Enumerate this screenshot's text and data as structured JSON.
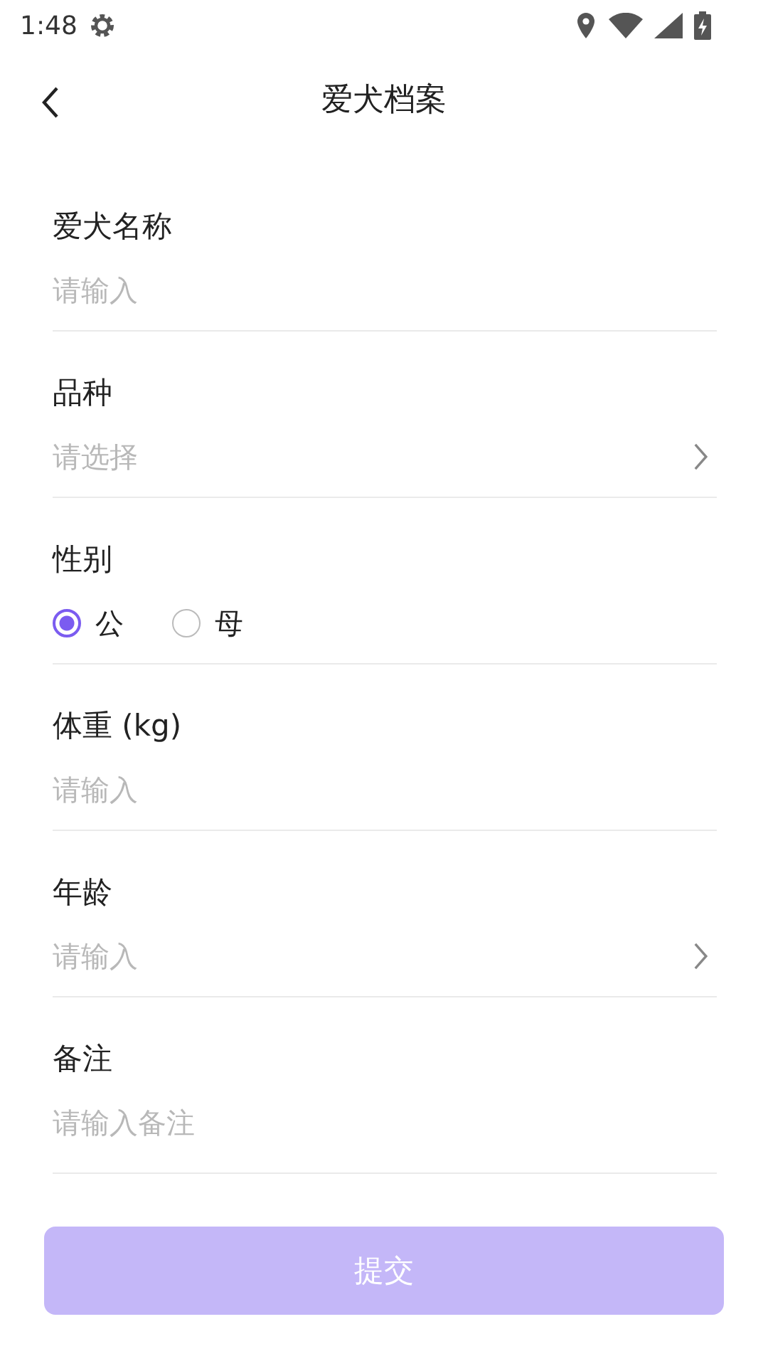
{
  "status_bar": {
    "time": "1:48"
  },
  "header": {
    "title": "爱犬档案"
  },
  "fields": [
    {
      "kind": "text",
      "label": "爱犬名称",
      "placeholder": "请输入"
    },
    {
      "kind": "select",
      "label": "品种",
      "placeholder": "请选择"
    },
    {
      "kind": "radio",
      "label": "性别",
      "options": [
        {
          "label": "公",
          "selected": true
        },
        {
          "label": "母",
          "selected": false
        }
      ]
    },
    {
      "kind": "text",
      "label": "体重 (kg)",
      "placeholder": "请输入"
    },
    {
      "kind": "select",
      "label": "年龄",
      "placeholder": "请输入"
    },
    {
      "kind": "text",
      "label": "备注",
      "placeholder": "请输入备注"
    }
  ],
  "submit": {
    "label": "提交"
  }
}
